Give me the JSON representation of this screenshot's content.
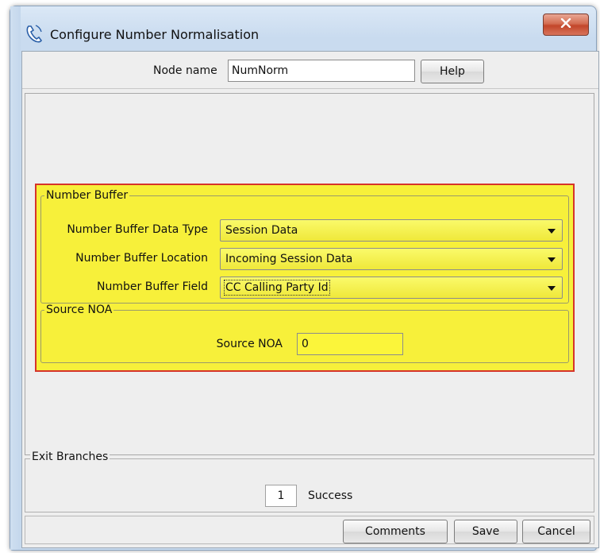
{
  "window": {
    "title": "Configure Number Normalisation",
    "close_label": "✕"
  },
  "node": {
    "label": "Node name",
    "value": "NumNorm",
    "help_label": "Help"
  },
  "number_buffer": {
    "legend": "Number Buffer",
    "fields": [
      {
        "label": "Number Buffer Data Type",
        "value": "Session Data"
      },
      {
        "label": "Number Buffer Location",
        "value": "Incoming Session Data"
      },
      {
        "label": "Number Buffer Field",
        "value": "CC Calling Party Id"
      }
    ]
  },
  "source_noa": {
    "legend": "Source NOA",
    "label": "Source NOA",
    "value": "0"
  },
  "exit_branches": {
    "legend": "Exit Branches",
    "number": "1",
    "label": "Success"
  },
  "buttons": {
    "comments": "Comments",
    "save": "Save",
    "cancel": "Cancel"
  },
  "colors": {
    "highlight_fill": "#f7f03a",
    "highlight_border": "#d6342a",
    "close_button": "#c2462a"
  },
  "icons": {
    "app": "phone-handset-icon",
    "close": "close-icon",
    "dropdown": "chevron-down-icon"
  }
}
